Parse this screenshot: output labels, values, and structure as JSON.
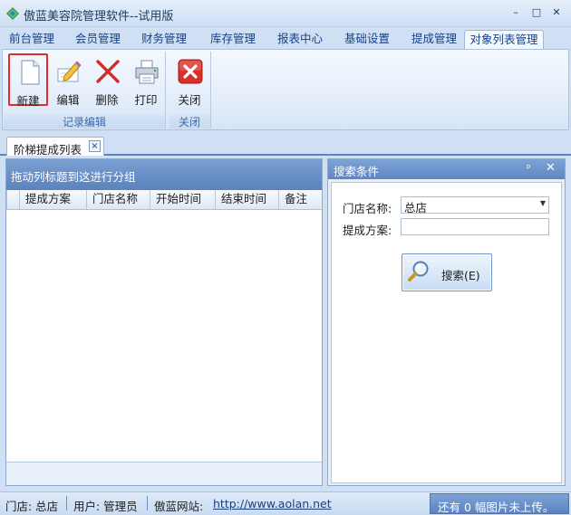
{
  "window": {
    "title": "傲蓝美容院管理软件--试用版",
    "minimize_glyph": "–",
    "maximize_glyph": "□",
    "close_glyph": "✕"
  },
  "tabs": [
    {
      "label": "前台管理"
    },
    {
      "label": "会员管理"
    },
    {
      "label": "财务管理"
    },
    {
      "label": "库存管理"
    },
    {
      "label": "报表中心"
    },
    {
      "label": "基础设置"
    },
    {
      "label": "提成管理"
    },
    {
      "label": "对象列表管理",
      "active": true
    }
  ],
  "ribbon": {
    "record_group": {
      "label": "记录编辑",
      "buttons": [
        {
          "label": "新建",
          "icon": "new-document-icon",
          "selected": true
        },
        {
          "label": "编辑",
          "icon": "edit-pencil-icon"
        },
        {
          "label": "删除",
          "icon": "delete-x-icon"
        },
        {
          "label": "打印",
          "icon": "printer-icon"
        }
      ]
    },
    "close_group": {
      "label": "关闭",
      "buttons": [
        {
          "label": "关闭",
          "icon": "close-red-icon"
        }
      ]
    }
  },
  "doc_tab": {
    "label": "阶梯提成列表",
    "close_glyph": "×"
  },
  "grid": {
    "group_panel_text": "拖动列标题到这进行分组",
    "columns": [
      "提成方案",
      "门店名称",
      "开始时间",
      "结束时间",
      "备注"
    ],
    "rows": []
  },
  "search_panel": {
    "title": "搜索条件",
    "pin_glyph": "ᵖ",
    "close_glyph": "✕",
    "fields": {
      "store": {
        "label": "门店名称:",
        "value": "总店",
        "dropdown_glyph": "▼"
      },
      "plan": {
        "label": "提成方案:",
        "value": ""
      }
    },
    "search_button": "搜索(E)"
  },
  "statusbar": {
    "store": "门店: 总店",
    "user": "用户: 管理员",
    "site_label": "傲蓝网站:",
    "site_url": "http://www.aolan.net",
    "upload_status": "还有 0 幅图片未上传。"
  },
  "colors": {
    "accent": "#15428b",
    "panel_header": "#5d86c3",
    "selection_border": "#e02c2c",
    "close_red": "#d9302a"
  }
}
